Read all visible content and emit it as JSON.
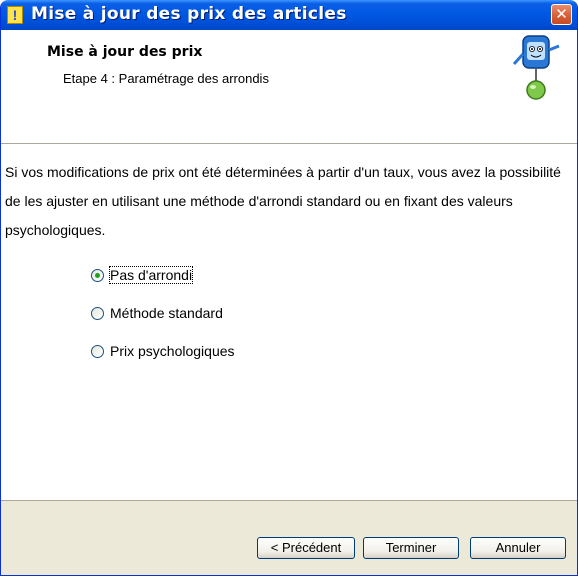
{
  "window": {
    "title": "Mise à jour des prix des articles"
  },
  "header": {
    "title": "Mise à jour des prix",
    "subtitle": "Etape 4 : Paramétrage des arrondis"
  },
  "content": {
    "description": "Si vos modifications de prix ont été déterminées à partir d'un taux, vous avez la possibilité de les ajuster en utilisant une méthode d'arrondi standard ou en fixant des valeurs psychologiques.",
    "options": [
      {
        "label": "Pas d'arrondi",
        "selected": true
      },
      {
        "label": "Méthode standard",
        "selected": false
      },
      {
        "label": "Prix psychologiques",
        "selected": false
      }
    ]
  },
  "buttons": {
    "previous": "< Précédent",
    "finish": "Terminer",
    "cancel": "Annuler"
  },
  "colors": {
    "titlebar": "#0058e2",
    "dialog_bg": "#ece9d8",
    "radio_dot": "#21a121"
  },
  "icons": [
    "alert-icon",
    "close-icon",
    "assistant-mascot-icon"
  ]
}
